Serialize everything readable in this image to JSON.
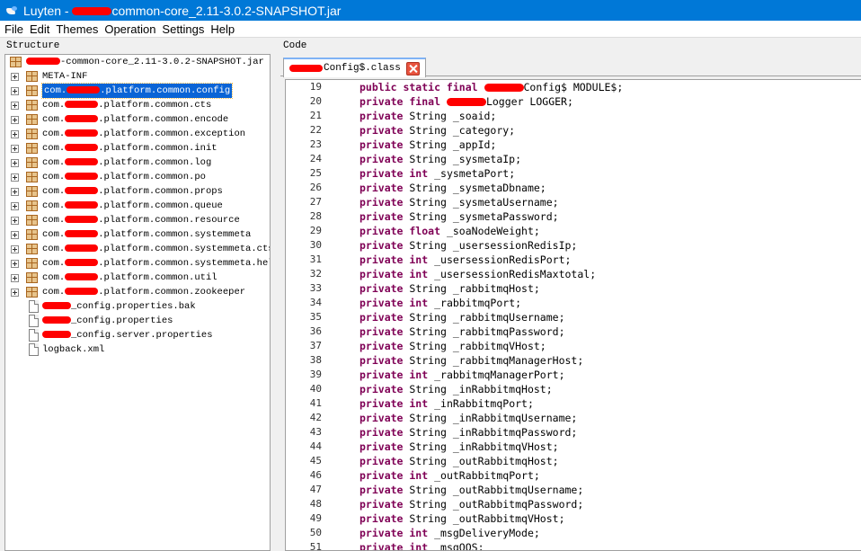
{
  "window": {
    "title_prefix": "Luyten - ",
    "title_suffix": "common-core_2.11-3.0.2-SNAPSHOT.jar"
  },
  "menu": [
    "File",
    "Edit",
    "Themes",
    "Operation",
    "Settings",
    "Help"
  ],
  "structure": {
    "label": "Structure",
    "root": "-common-core_2.11-3.0.2-SNAPSHOT.jar",
    "packages": [
      {
        "pre": "META-INF",
        "post": ""
      },
      {
        "pre": "com.",
        "post": ".platform.common.config"
      },
      {
        "pre": "com.",
        "post": ".platform.common.cts"
      },
      {
        "pre": "com.",
        "post": ".platform.common.encode"
      },
      {
        "pre": "com.",
        "post": ".platform.common.exception"
      },
      {
        "pre": "com.",
        "post": ".platform.common.init"
      },
      {
        "pre": "com.",
        "post": ".platform.common.log"
      },
      {
        "pre": "com.",
        "post": ".platform.common.po"
      },
      {
        "pre": "com.",
        "post": ".platform.common.props"
      },
      {
        "pre": "com.",
        "post": ".platform.common.queue"
      },
      {
        "pre": "com.",
        "post": ".platform.common.resource"
      },
      {
        "pre": "com.",
        "post": ".platform.common.systemmeta"
      },
      {
        "pre": "com.",
        "post": ".platform.common.systemmeta.cts."
      },
      {
        "pre": "com.",
        "post": ".platform.common.systemmeta.help"
      },
      {
        "pre": "com.",
        "post": ".platform.common.util"
      },
      {
        "pre": "com.",
        "post": ".platform.common.zookeeper"
      }
    ],
    "files": [
      "_config.properties.bak",
      "_config.properties",
      "_config.server.properties",
      "logback.xml"
    ]
  },
  "code_panel": {
    "label": "Code",
    "tab_label": "Config$.class",
    "lines": [
      {
        "n": "19",
        "kw": "public static final",
        "rest": "Config$ MODULE$;",
        "redact": true
      },
      {
        "n": "20",
        "kw": "private final",
        "rest": "Logger LOGGER;",
        "redact": true
      },
      {
        "n": "21",
        "kw": "private",
        "rest": "String _soaid;"
      },
      {
        "n": "22",
        "kw": "private",
        "rest": "String _category;"
      },
      {
        "n": "23",
        "kw": "private",
        "rest": "String _appId;"
      },
      {
        "n": "24",
        "kw": "private",
        "rest": "String _sysmetaIp;"
      },
      {
        "n": "25",
        "kw": "private int",
        "rest": "_sysmetaPort;"
      },
      {
        "n": "26",
        "kw": "private",
        "rest": "String _sysmetaDbname;"
      },
      {
        "n": "27",
        "kw": "private",
        "rest": "String _sysmetaUsername;"
      },
      {
        "n": "28",
        "kw": "private",
        "rest": "String _sysmetaPassword;"
      },
      {
        "n": "29",
        "kw": "private float",
        "rest": "_soaNodeWeight;"
      },
      {
        "n": "30",
        "kw": "private",
        "rest": "String _usersessionRedisIp;"
      },
      {
        "n": "31",
        "kw": "private int",
        "rest": "_usersessionRedisPort;"
      },
      {
        "n": "32",
        "kw": "private int",
        "rest": "_usersessionRedisMaxtotal;"
      },
      {
        "n": "33",
        "kw": "private",
        "rest": "String _rabbitmqHost;"
      },
      {
        "n": "34",
        "kw": "private int",
        "rest": "_rabbitmqPort;"
      },
      {
        "n": "35",
        "kw": "private",
        "rest": "String _rabbitmqUsername;"
      },
      {
        "n": "36",
        "kw": "private",
        "rest": "String _rabbitmqPassword;"
      },
      {
        "n": "37",
        "kw": "private",
        "rest": "String _rabbitmqVHost;"
      },
      {
        "n": "38",
        "kw": "private",
        "rest": "String _rabbitmqManagerHost;"
      },
      {
        "n": "39",
        "kw": "private int",
        "rest": "_rabbitmqManagerPort;"
      },
      {
        "n": "40",
        "kw": "private",
        "rest": "String _inRabbitmqHost;"
      },
      {
        "n": "41",
        "kw": "private int",
        "rest": "_inRabbitmqPort;"
      },
      {
        "n": "42",
        "kw": "private",
        "rest": "String _inRabbitmqUsername;"
      },
      {
        "n": "43",
        "kw": "private",
        "rest": "String _inRabbitmqPassword;"
      },
      {
        "n": "44",
        "kw": "private",
        "rest": "String _inRabbitmqVHost;"
      },
      {
        "n": "45",
        "kw": "private",
        "rest": "String _outRabbitmqHost;"
      },
      {
        "n": "46",
        "kw": "private int",
        "rest": "_outRabbitmqPort;"
      },
      {
        "n": "47",
        "kw": "private",
        "rest": "String _outRabbitmqUsername;"
      },
      {
        "n": "48",
        "kw": "private",
        "rest": "String _outRabbitmqPassword;"
      },
      {
        "n": "49",
        "kw": "private",
        "rest": "String _outRabbitmqVHost;"
      },
      {
        "n": "50",
        "kw": "private int",
        "rest": "_msgDeliveryMode;"
      },
      {
        "n": "51",
        "kw": "private int",
        "rest": "_msgQOS;"
      }
    ]
  },
  "colors": {
    "titlebar": "#0078d7",
    "keyword": "#7f0055",
    "selection": "#0a64d6",
    "redaction": "#ff0000",
    "close_button": "#e8533e"
  }
}
